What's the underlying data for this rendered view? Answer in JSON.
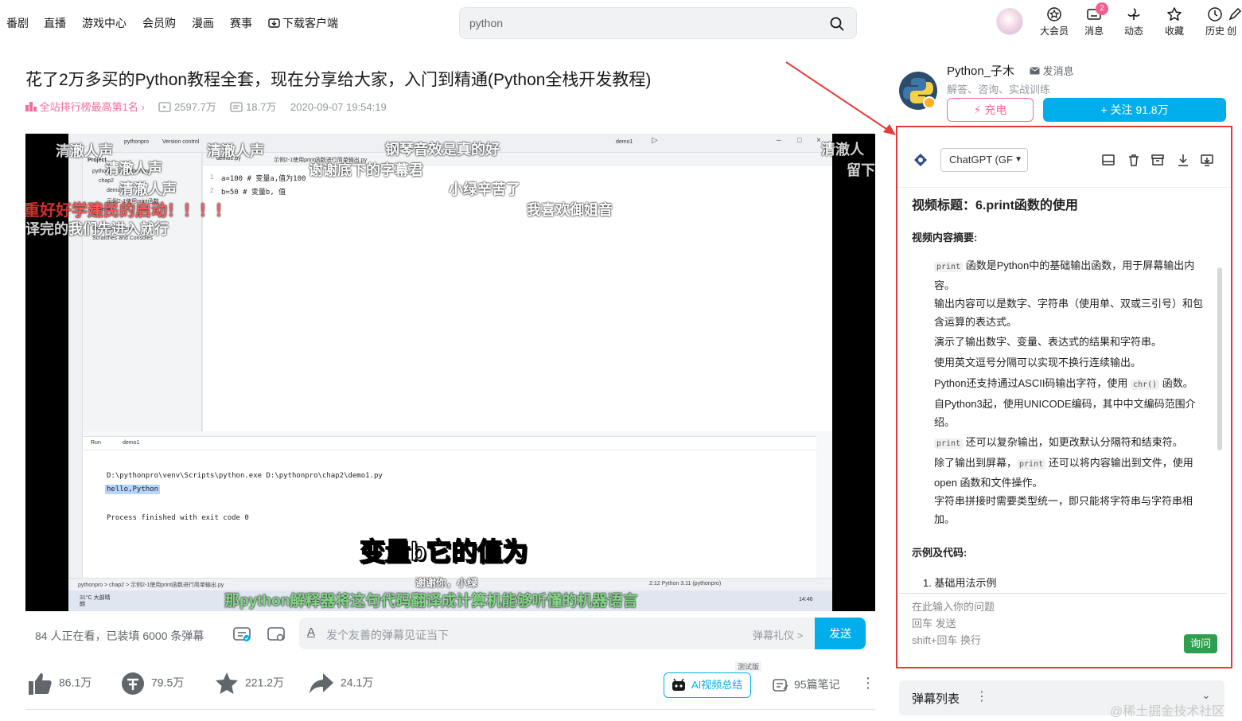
{
  "nav": {
    "items": [
      "番剧",
      "直播",
      "游戏中心",
      "会员购",
      "漫画",
      "赛事",
      "下载客户端"
    ],
    "search_value": "python",
    "icons": [
      {
        "label": "大会员",
        "icon": "vip-icon"
      },
      {
        "label": "消息",
        "icon": "message-icon",
        "badge": "2"
      },
      {
        "label": "动态",
        "icon": "dynamic-icon"
      },
      {
        "label": "收藏",
        "icon": "star-icon"
      },
      {
        "label": "历史",
        "icon": "clock-icon"
      },
      {
        "label": "创",
        "icon": "create-icon"
      }
    ]
  },
  "video": {
    "title": "花了2万多买的Python教程全套，现在分享给大家，入门到精通(Python全栈开发教程)",
    "rank": "全站排行榜最高第1名",
    "views": "2597.7万",
    "danmaku_count": "18.7万",
    "date": "2020-09-07 19:54:19",
    "subtitle": "变量b它的值为",
    "bottom_danmaku": "那python解释器将这句代码翻译成计算机能够听懂的机器语言",
    "danmaku": [
      "清澈人声",
      "清澈人声",
      "钢琴音效是真的好",
      "谢谢底下的字幕君",
      "小绿辛苦了",
      "我喜欢御姐音",
      "清澈人声",
      "清澈人声",
      "谢谢你，小绿",
      "清澈人",
      "留下",
      "重好好学建民的启动！！！！",
      "译完的我们先进入就行"
    ],
    "ide": {
      "project_label": "Project",
      "menu_project": "pythonpro",
      "menu_vc": "Version control",
      "run_config": "demo1",
      "tab1": "demo1.py",
      "tab2": "示例2-1使用print函数进行简单输出.py",
      "tree": [
        "pythonpro D:\\pythonpro",
        "chap2",
        "demo1.py",
        "示例2-1使用print函数",
        "venv",
        "External Libraries",
        "Scratches and Consoles"
      ],
      "code_line1": "a=100  # 变量a,值为100",
      "code_line2": "b=50  # 变量b, 值",
      "run_label": "Run",
      "run_tab": "demo1",
      "console1": "D:\\pythonpro\\venv\\Scripts\\python.exe D:\\pythonpro\\chap2\\demo1.py",
      "console2": "hello,Python",
      "console3": "Process finished with exit code 0",
      "status_path": "pythonpro  >  chap2  >  示例2-1使用print函数进行简单输出.py",
      "status_right": "2:12   Python 3.11 (pythonpro)",
      "taskbar_weather": "31°C 大部晴朗",
      "taskbar_time": "14:46"
    }
  },
  "danmaku_bar": {
    "watching": "84 人正在看，已装填 6000 条弹幕",
    "placeholder": "发个友善的弹幕见证当下",
    "etiquette": "弹幕礼仪 >",
    "send": "发送"
  },
  "toolbar": {
    "like": "86.1万",
    "coin": "79.5万",
    "favorite": "221.2万",
    "share": "24.1万",
    "ai_summary": "AI视频总结",
    "ai_badge": "测试版",
    "notes": "95篇笔记"
  },
  "uploader": {
    "name": "Python_子木",
    "message": "发消息",
    "desc": "解答、咨询、实战训练",
    "charge": "充电",
    "follow": "+ 关注 91.8万"
  },
  "ai_panel": {
    "model": "ChatGPT (GF",
    "video_title": "视频标题：6.print函数的使用",
    "summary_heading": "视频内容摘要:",
    "bullets": [
      {
        "pre": "",
        "code": "print",
        "post": " 函数是Python中的基础输出函数，用于屏幕输出内容。"
      },
      {
        "pre": "输出内容可以是数字、字符串（使用单、双或三引号）和包含运算的表达式。",
        "code": "",
        "post": ""
      },
      {
        "pre": "演示了输出数字、变量、表达式的结果和字符串。",
        "code": "",
        "post": ""
      },
      {
        "pre": "使用英文逗号分隔可以实现不换行连续输出。",
        "code": "",
        "post": ""
      },
      {
        "pre": "Python还支持通过ASCII码输出字符，使用 ",
        "code": "chr()",
        "post": " 函数。"
      },
      {
        "pre": "自Python3起，使用UNICODE编码，其中中文编码范围介绍。",
        "code": "",
        "post": ""
      },
      {
        "pre": "",
        "code": "print",
        "post": " 还可以复杂输出，如更改默认分隔符和结束符。"
      },
      {
        "pre": "除了输出到屏幕，",
        "code": "print",
        "post": " 还可以将内容输出到文件，使用 open 函数和文件操作。"
      },
      {
        "pre": "字符串拼接时需要类型统一，即只能将字符串与字符串相加。",
        "code": "",
        "post": ""
      }
    ],
    "examples_heading": "示例及代码:",
    "example1": "1. 基础用法示例",
    "input_placeholder": "在此输入你的问题\n回车 发送\nshift+回车 换行",
    "ask": "询问"
  },
  "danmaku_list": {
    "label": "弹幕列表"
  },
  "watermark": "@稀土掘金技术社区",
  "colors": {
    "accent": "#00aeec",
    "pink": "#ff6699",
    "highlight_box": "#e43b3b",
    "ask_button": "#2e9f4f"
  }
}
